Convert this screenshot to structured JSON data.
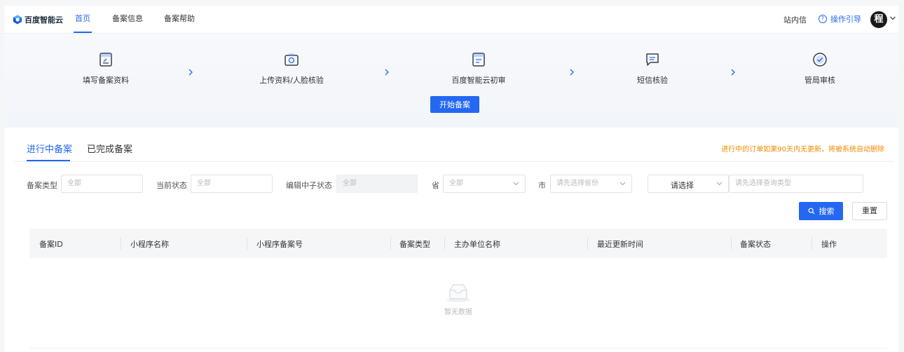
{
  "nav": {
    "logo_text": "百度智能云",
    "items": [
      {
        "label": "首页",
        "active": true
      },
      {
        "label": "备案信息",
        "active": false
      },
      {
        "label": "备案帮助",
        "active": false
      }
    ],
    "message_label": "站内信",
    "help_label": "操作引导",
    "avatar_char": "程"
  },
  "steps": [
    {
      "label": "填写备案资料",
      "icon": "form-edit-icon"
    },
    {
      "label": "上传资料/人脸核验",
      "icon": "camera-upload-icon"
    },
    {
      "label": "百度智能云初审",
      "icon": "document-review-icon"
    },
    {
      "label": "短信核验",
      "icon": "sms-message-icon"
    },
    {
      "label": "管局审核",
      "icon": "check-circle-icon"
    }
  ],
  "start_button": "开始备案",
  "tabs": [
    {
      "label": "进行中备案",
      "active": true
    },
    {
      "label": "已完成备案",
      "active": false
    }
  ],
  "warning": "进行中的订单如果90天内无更新，将被系统自动删除",
  "filters": {
    "type_label": "备案类型",
    "type_placeholder": "全部",
    "status_label": "当前状态",
    "status_placeholder": "全部",
    "edit_status_label": "编辑中子状态",
    "edit_status_placeholder": "全部",
    "province_label": "省",
    "province_placeholder": "全部",
    "city_label": "市",
    "city_placeholder": "请先选择省份",
    "query_type_label": "请选择",
    "query_placeholder": "请先选择查询类型"
  },
  "buttons": {
    "search": "搜索",
    "reset": "重置"
  },
  "table": {
    "columns": [
      "备案ID",
      "小程序名称",
      "小程序备案号",
      "备案类型",
      "主办单位名称",
      "最近更新时间",
      "备案状态",
      "操作"
    ],
    "rows": [],
    "empty_text": "暂无数据"
  },
  "colors": {
    "primary": "#2468f2",
    "warning": "#f38900"
  }
}
